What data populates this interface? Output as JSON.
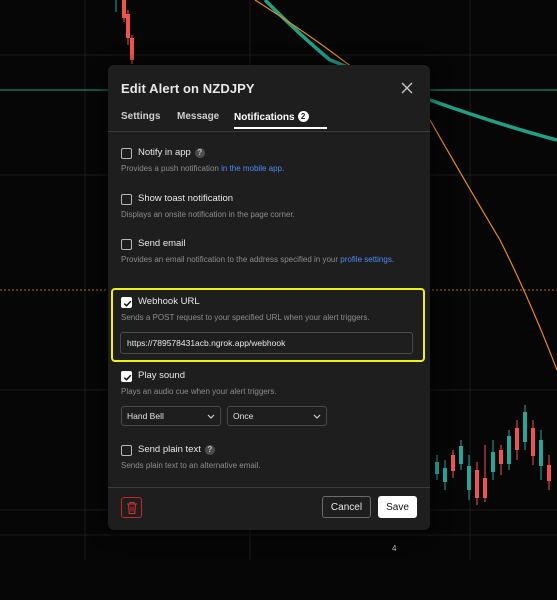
{
  "dialog": {
    "title": "Edit Alert on NZDJPY",
    "tabs": [
      {
        "label": "Settings"
      },
      {
        "label": "Message"
      },
      {
        "label": "Notifications",
        "badge": "2",
        "active": true
      }
    ]
  },
  "options": {
    "notify_app": {
      "label": "Notify in app",
      "checked": false,
      "desc": "Provides a push notification",
      "link": "in the mobile app",
      "desc_end": "."
    },
    "toast": {
      "label": "Show toast notification",
      "checked": false,
      "desc": "Displays an onsite notification in the page corner."
    },
    "email": {
      "label": "Send email",
      "checked": false,
      "desc": "Provides an email notification to the address specified in your",
      "link": "profile settings",
      "desc_end": "."
    },
    "webhook": {
      "label": "Webhook URL",
      "checked": true,
      "desc": "Sends a POST request to your specified URL when your alert triggers.",
      "url": "https://789578431acb.ngrok.app/webhook"
    },
    "sound": {
      "label": "Play sound",
      "checked": true,
      "desc": "Plays an audio cue when your alert triggers.",
      "sound_name": "Hand Bell",
      "repeat": "Once"
    },
    "plain_text": {
      "label": "Send plain text",
      "checked": false,
      "desc": "Sends plain text to an alternative email."
    }
  },
  "footer": {
    "cancel_label": "Cancel",
    "save_label": "Save"
  },
  "chart": {
    "axis_label": "4",
    "colors": {
      "up": "#26a69a",
      "down": "#ef5350",
      "ma_slow": "#1fa085",
      "ma_fast": "#e58a1f",
      "highlight": "#f0f014"
    }
  }
}
